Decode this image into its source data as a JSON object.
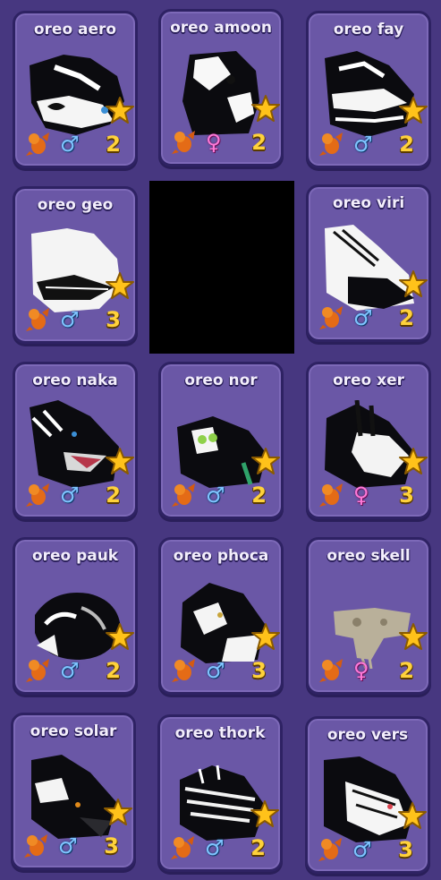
{
  "colors": {
    "background": "#473780",
    "card": "#6a57a6",
    "card_border": "#2e2263",
    "star": "#ffc21a",
    "level": "#ffd23b",
    "male": "#7fc4ff",
    "female": "#ff7ad9"
  },
  "pets": [
    {
      "name": "oreo aero",
      "gender": "male",
      "gender_symbol": "♂",
      "level": "2",
      "portrait_icon": "black-white-dragon-icon"
    },
    {
      "name": "oreo amoon",
      "gender": "female",
      "gender_symbol": "♀",
      "level": "2",
      "portrait_icon": "black-white-dragon-icon"
    },
    {
      "name": "oreo fay",
      "gender": "male",
      "gender_symbol": "♂",
      "level": "2",
      "portrait_icon": "black-white-dragon-icon"
    },
    {
      "name": "oreo geo",
      "gender": "male",
      "gender_symbol": "♂",
      "level": "3",
      "portrait_icon": "white-dragon-icon"
    },
    {
      "name": "oreo viri",
      "gender": "male",
      "gender_symbol": "♂",
      "level": "2",
      "portrait_icon": "black-white-dragon-icon"
    },
    {
      "name": "oreo naka",
      "gender": "male",
      "gender_symbol": "♂",
      "level": "2",
      "portrait_icon": "black-white-dragon-icon"
    },
    {
      "name": "oreo nor",
      "gender": "male",
      "gender_symbol": "♂",
      "level": "2",
      "portrait_icon": "black-dragon-icon"
    },
    {
      "name": "oreo xer",
      "gender": "female",
      "gender_symbol": "♀",
      "level": "3",
      "portrait_icon": "black-white-dragon-icon"
    },
    {
      "name": "oreo pauk",
      "gender": "male",
      "gender_symbol": "♂",
      "level": "2",
      "portrait_icon": "black-white-dragon-icon"
    },
    {
      "name": "oreo phoca",
      "gender": "male",
      "gender_symbol": "♂",
      "level": "3",
      "portrait_icon": "black-white-dragon-icon"
    },
    {
      "name": "oreo skell",
      "gender": "female",
      "gender_symbol": "♀",
      "level": "2",
      "portrait_icon": "skull-dragon-icon"
    },
    {
      "name": "oreo solar",
      "gender": "male",
      "gender_symbol": "♂",
      "level": "3",
      "portrait_icon": "black-dragon-icon"
    },
    {
      "name": "oreo thork",
      "gender": "male",
      "gender_symbol": "♂",
      "level": "2",
      "portrait_icon": "black-white-dragon-icon"
    },
    {
      "name": "oreo vers",
      "gender": "male",
      "gender_symbol": "♂",
      "level": "3",
      "portrait_icon": "black-white-dragon-icon"
    }
  ]
}
